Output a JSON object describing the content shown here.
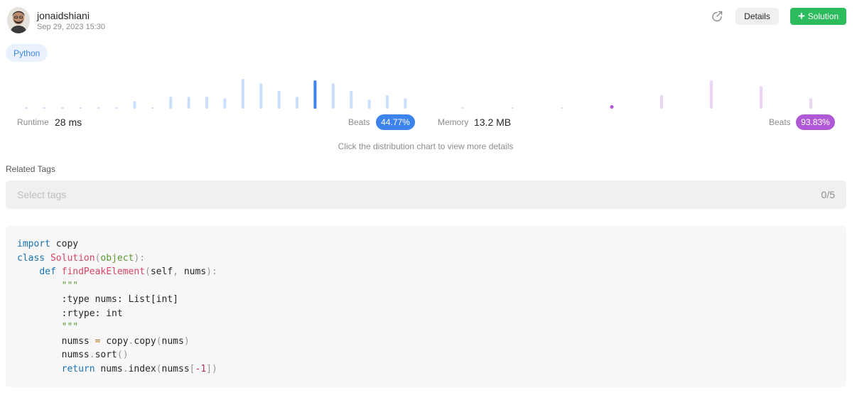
{
  "submission": {
    "username": "jonaidshiani",
    "timestamp": "Sep 29, 2023 15:30",
    "language": "Python"
  },
  "actions": {
    "share_icon": "share-icon",
    "details_label": "Details",
    "solution_label": "Solution",
    "solution_icon": "plus"
  },
  "runtime": {
    "label": "Runtime",
    "value": "28 ms",
    "beats_label": "Beats",
    "beats_percent": "44.77%"
  },
  "memory": {
    "label": "Memory",
    "value": "13.2 MB",
    "beats_label": "Beats",
    "beats_percent": "93.83%"
  },
  "hint": "Click the distribution chart to view more details",
  "related_tags": {
    "title": "Related Tags",
    "placeholder": "Select tags",
    "count": "0/5"
  },
  "code_lines": [
    "import copy",
    "class Solution(object):",
    "    def findPeakElement(self, nums):",
    "        \"\"\"",
    "        :type nums: List[int]",
    "        :rtype: int",
    "        \"\"\"",
    "        numss = copy.copy(nums)",
    "        numss.sort()",
    "        return nums.index(numss[-1])"
  ],
  "colors": {
    "runtime_accent": "#3c83ec",
    "runtime_bar": "#c9dffb",
    "memory_accent": "#b059d7",
    "memory_bar": "#ecd5f5",
    "solution_green": "#2cbb5d"
  },
  "chart_data": {
    "type": "bar",
    "series": [
      {
        "metric": "runtime",
        "values": [
          0.05,
          0.05,
          0.05,
          0.05,
          0.05,
          0.05,
          0.25,
          0.05,
          0.4,
          0.4,
          0.4,
          0.35,
          1.0,
          0.85,
          0.6,
          0.4,
          0.95,
          0.85,
          0.6,
          0.3,
          0.45,
          0.35
        ],
        "highlight_index": 16
      },
      {
        "metric": "memory",
        "values": [
          0.05,
          0.05,
          0.05,
          0.1,
          0.45,
          0.95,
          0.75,
          0.35
        ],
        "highlight_index": 3
      }
    ]
  }
}
